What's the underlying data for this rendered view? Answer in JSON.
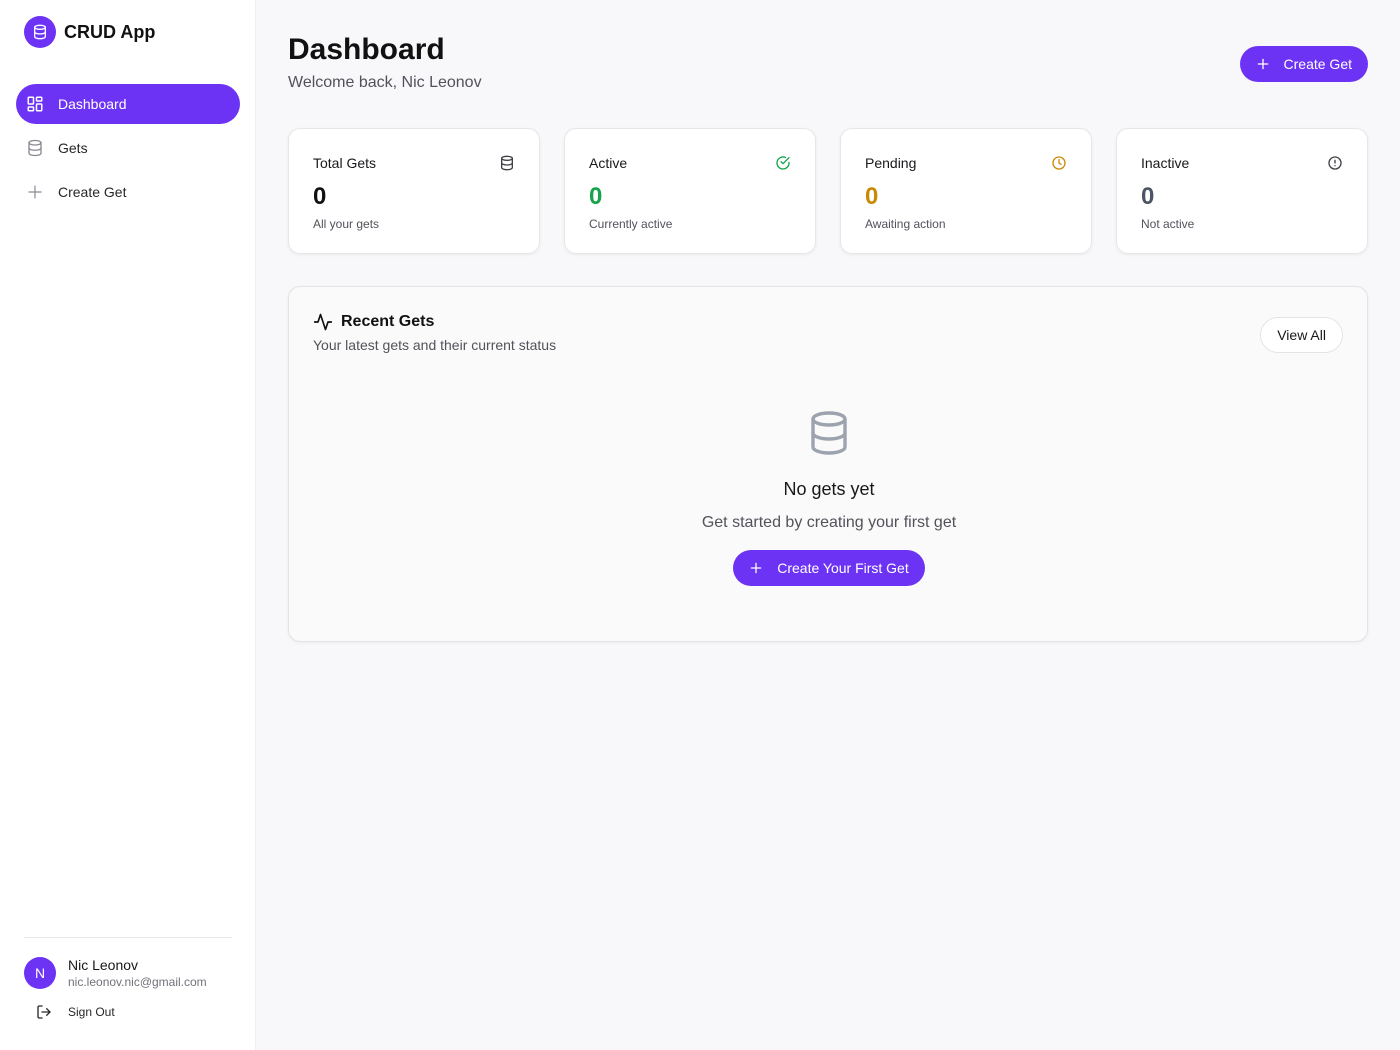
{
  "app": {
    "name": "CRUD App",
    "logo_icon": "database-icon"
  },
  "sidebar": {
    "items": [
      {
        "label": "Dashboard",
        "icon": "layout-dashboard-icon",
        "active": true
      },
      {
        "label": "Gets",
        "icon": "database-icon",
        "active": false
      },
      {
        "label": "Create Get",
        "icon": "plus-icon",
        "active": false
      }
    ]
  },
  "user": {
    "initial": "N",
    "name": "Nic Leonov",
    "email": "nic.leonov.nic@gmail.com",
    "sign_out_label": "Sign Out"
  },
  "header": {
    "title": "Dashboard",
    "subtitle": "Welcome back, Nic Leonov",
    "create_button_label": "Create Get"
  },
  "stats": [
    {
      "label": "Total Gets",
      "value": "0",
      "description": "All your gets",
      "icon": "database-icon",
      "color": "#111111"
    },
    {
      "label": "Active",
      "value": "0",
      "description": "Currently active",
      "icon": "check-circle-icon",
      "color": "#16a34a"
    },
    {
      "label": "Pending",
      "value": "0",
      "description": "Awaiting action",
      "icon": "clock-icon",
      "color": "#ca8a04"
    },
    {
      "label": "Inactive",
      "value": "0",
      "description": "Not active",
      "icon": "alert-circle-icon",
      "color": "#4b5563"
    }
  ],
  "recent": {
    "title": "Recent Gets",
    "subtitle": "Your latest gets and their current status",
    "view_all_label": "View All",
    "empty": {
      "title": "No gets yet",
      "subtitle": "Get started by creating your first get",
      "button_label": "Create Your First Get"
    }
  },
  "colors": {
    "accent": "#6d33f5",
    "background": "#f8f8fa"
  }
}
